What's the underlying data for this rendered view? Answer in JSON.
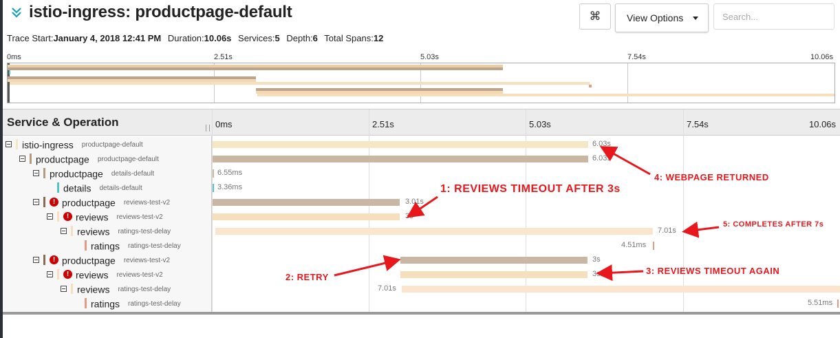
{
  "colors": {
    "istio_ingress": "#f5e6c4",
    "productpage": "#c2aa93",
    "productpage_light": "#f4d7b3",
    "details": "#56c1c9",
    "reviews": "#f6dfbc",
    "ratings": "#f5d3b2",
    "ratings_marker": "#e59a82",
    "productpage_marker": "#8c6a4f",
    "accent": "#18a0b1",
    "annotation": "#e8171c"
  },
  "header": {
    "title": "istio-ingress: productpage-default",
    "collapse_icon": "chevron-double-down-icon",
    "cmd_icon": "⌘",
    "view_options_label": "View Options",
    "search_placeholder": "Search..."
  },
  "meta": {
    "trace_start_key": "Trace Start:",
    "trace_start": "January 4, 2018 12:41 PM",
    "duration_key": "Duration:",
    "duration": "10.06s",
    "services_key": "Services:",
    "services": "5",
    "depth_key": "Depth:",
    "depth": "6",
    "total_spans_key": "Total Spans:",
    "total_spans": "12"
  },
  "ticks": [
    "0ms",
    "2.51s",
    "5.03s",
    "7.54s",
    "10.06s"
  ],
  "graph": {
    "column_title": "Service & Operation"
  },
  "spans": [
    {
      "service": "istio-ingress",
      "operation": "productpage-default",
      "duration": "6.03s",
      "error": false
    },
    {
      "service": "productpage",
      "operation": "productpage-default",
      "duration": "6.03s",
      "error": false
    },
    {
      "service": "productpage",
      "operation": "details-default",
      "duration": "6.55ms",
      "error": false
    },
    {
      "service": "details",
      "operation": "details-default",
      "duration": "3.36ms",
      "error": false
    },
    {
      "service": "productpage",
      "operation": "reviews-test-v2",
      "duration": "3.01s",
      "error": true
    },
    {
      "service": "reviews",
      "operation": "reviews-test-v2",
      "duration": "3s",
      "error": true
    },
    {
      "service": "reviews",
      "operation": "ratings-test-delay",
      "duration": "7.01s",
      "error": false
    },
    {
      "service": "ratings",
      "operation": "ratings-test-delay",
      "duration": "4.51ms",
      "error": false
    },
    {
      "service": "productpage",
      "operation": "reviews-test-v2",
      "duration": "3s",
      "error": true
    },
    {
      "service": "reviews",
      "operation": "reviews-test-v2",
      "duration": "3s",
      "error": true
    },
    {
      "service": "reviews",
      "operation": "ratings-test-delay",
      "duration": "7.01s",
      "error": false
    },
    {
      "service": "ratings",
      "operation": "ratings-test-delay",
      "duration": "5.51ms",
      "error": false
    }
  ],
  "annotations": {
    "a1": "1: REVIEWS TIMEOUT AFTER 3s",
    "a2": "2: RETRY",
    "a3": "3: REVIEWS TIMEOUT AGAIN",
    "a4": "4: WEBPAGE RETURNED",
    "a5": "5: COMPLETES AFTER 7s"
  }
}
